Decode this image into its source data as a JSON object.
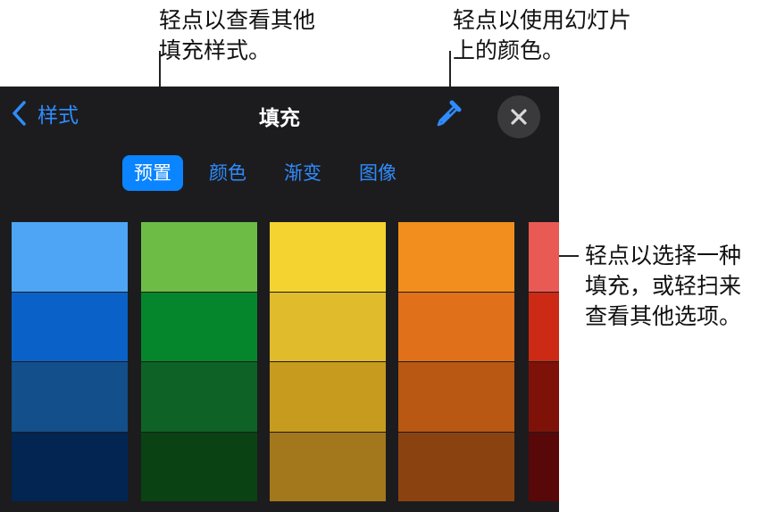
{
  "callouts": {
    "top_left": [
      "轻点以查看其他",
      "填充样式。"
    ],
    "top_right": [
      "轻点以使用幻灯片",
      "上的颜色。"
    ],
    "right": [
      "轻点以选择一种",
      "填充，或轻扫来",
      "查看其他选项。"
    ]
  },
  "panel": {
    "back_label": "样式",
    "title": "填充",
    "tabs": [
      "预置",
      "颜色",
      "渐变",
      "图像"
    ],
    "active_tab": "预置"
  },
  "icons": {
    "back": "chevron-left-icon",
    "dropper": "eyedropper-icon",
    "close": "close-icon"
  },
  "colors": {
    "accent": "#0a84ff",
    "panel_bg": "#1c1c1e"
  },
  "swatches": [
    [
      "#4fa5f5",
      "#0a62c8",
      "#134f8a",
      "#022552"
    ],
    [
      "#6dbc45",
      "#05862c",
      "#0e6226",
      "#0a4214"
    ],
    [
      "#f4d330",
      "#e0bb2c",
      "#c69b1e",
      "#a3771b"
    ],
    [
      "#f28e1d",
      "#e0701a",
      "#b85812",
      "#8a4210"
    ],
    [
      "#ea5a54",
      "#cc2a15",
      "#7e1208",
      "#580808"
    ]
  ]
}
